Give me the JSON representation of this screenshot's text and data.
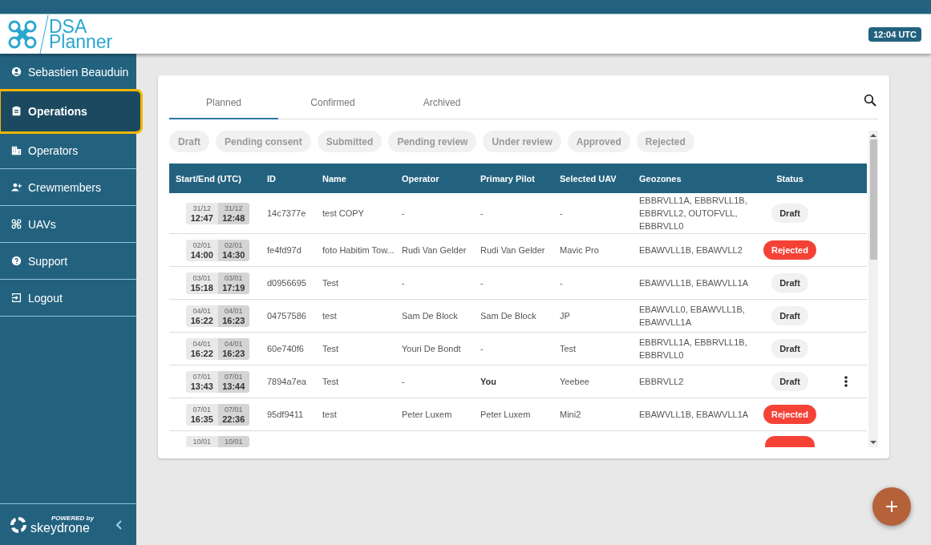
{
  "header": {
    "logo_top": "DSA",
    "logo_bottom": "Planner",
    "clock": "12:04 UTC"
  },
  "sidebar": {
    "items": [
      {
        "kind": "user",
        "label": "Sebastien Beauduin",
        "selected": false
      },
      {
        "kind": "operations",
        "label": "Operations",
        "selected": true
      },
      {
        "kind": "operators",
        "label": "Operators",
        "selected": false
      },
      {
        "kind": "crew",
        "label": "Crewmembers",
        "selected": false
      },
      {
        "kind": "uav",
        "label": "UAVs",
        "selected": false
      },
      {
        "kind": "support",
        "label": "Support",
        "selected": false
      },
      {
        "kind": "logout",
        "label": "Logout",
        "selected": false
      }
    ],
    "footer": {
      "powered": "POWERED by",
      "brand": "skeydrone"
    }
  },
  "tabs": [
    {
      "label": "Planned",
      "selected": true
    },
    {
      "label": "Confirmed",
      "selected": false
    },
    {
      "label": "Archived",
      "selected": false
    }
  ],
  "filters": [
    {
      "label": "Draft",
      "selected": false
    },
    {
      "label": "Pending consent",
      "selected": false
    },
    {
      "label": "Submitted",
      "selected": false
    },
    {
      "label": "Pending review",
      "selected": false
    },
    {
      "label": "Under review",
      "selected": false
    },
    {
      "label": "Approved",
      "selected": false
    },
    {
      "label": "Rejected",
      "selected": false
    }
  ],
  "table": {
    "columns": [
      "Start/End (UTC)",
      "ID",
      "Name",
      "Operator",
      "Primary Pilot",
      "Selected UAV",
      "Geozones",
      "Status"
    ],
    "rows": [
      {
        "start_date": "31/12",
        "start_time": "12:47",
        "end_date": "31/12",
        "end_time": "12:48",
        "id": "14c7377e",
        "name": "test COPY",
        "operator": "-",
        "pilot": "-",
        "pilot_bold": false,
        "uav": "-",
        "geozones": "EBBRVLL1A, EBBRVLL1B, EBBRVLL2, OUTOFVLL, EBBRVLL0",
        "status": {
          "kind": "draft",
          "label": "Draft"
        },
        "menu": false
      },
      {
        "start_date": "02/01",
        "start_time": "14:00",
        "end_date": "02/01",
        "end_time": "14:30",
        "id": "fe4fd97d",
        "name": "foto Habitim Tow...",
        "operator": "Rudi Van Gelder",
        "pilot": "Rudi Van Gelder",
        "pilot_bold": false,
        "uav": "Mavic Pro",
        "geozones": "EBAWVLL1B, EBAWVLL2",
        "status": {
          "kind": "rejected",
          "label": "Rejected"
        },
        "menu": false
      },
      {
        "start_date": "03/01",
        "start_time": "15:18",
        "end_date": "03/01",
        "end_time": "17:19",
        "id": "d0956695",
        "name": "Test",
        "operator": "-",
        "pilot": "-",
        "pilot_bold": false,
        "uav": "-",
        "geozones": "EBAWVLL1B, EBAWVLL1A",
        "status": {
          "kind": "draft",
          "label": "Draft"
        },
        "menu": false
      },
      {
        "start_date": "04/01",
        "start_time": "16:22",
        "end_date": "04/01",
        "end_time": "16:23",
        "id": "04757586",
        "name": "test",
        "operator": "Sam De Block",
        "pilot": "Sam De Block",
        "pilot_bold": false,
        "uav": "JP",
        "geozones": "EBAWVLL0, EBAWVLL1B, EBAWVLL1A",
        "status": {
          "kind": "draft",
          "label": "Draft"
        },
        "menu": false
      },
      {
        "start_date": "04/01",
        "start_time": "16:22",
        "end_date": "04/01",
        "end_time": "16:23",
        "id": "60e740f6",
        "name": "Test",
        "operator": "Youri De Bondt",
        "pilot": "-",
        "pilot_bold": false,
        "uav": "Test",
        "geozones": "EBBRVLL1A, EBBRVLL1B, EBBRVLL0",
        "status": {
          "kind": "draft",
          "label": "Draft"
        },
        "menu": false
      },
      {
        "start_date": "07/01",
        "start_time": "13:43",
        "end_date": "07/01",
        "end_time": "13:44",
        "id": "7894a7ea",
        "name": "Test",
        "operator": "-",
        "pilot": "You",
        "pilot_bold": true,
        "uav": "Yeebee",
        "geozones": "EBBRVLL2",
        "status": {
          "kind": "draft",
          "label": "Draft"
        },
        "menu": true
      },
      {
        "start_date": "07/01",
        "start_time": "16:35",
        "end_date": "07/01",
        "end_time": "22:36",
        "id": "95df9411",
        "name": "test",
        "operator": "Peter Luxem",
        "pilot": "Peter Luxem",
        "pilot_bold": false,
        "uav": "Mini2",
        "geozones": "EBAWVLL1B, EBAWVLL1A",
        "status": {
          "kind": "rejected",
          "label": "Rejected"
        },
        "menu": false
      },
      {
        "start_date": "10/01",
        "end_date": "10/01",
        "status": {
          "kind": "rejected"
        },
        "menu": false
      }
    ]
  }
}
